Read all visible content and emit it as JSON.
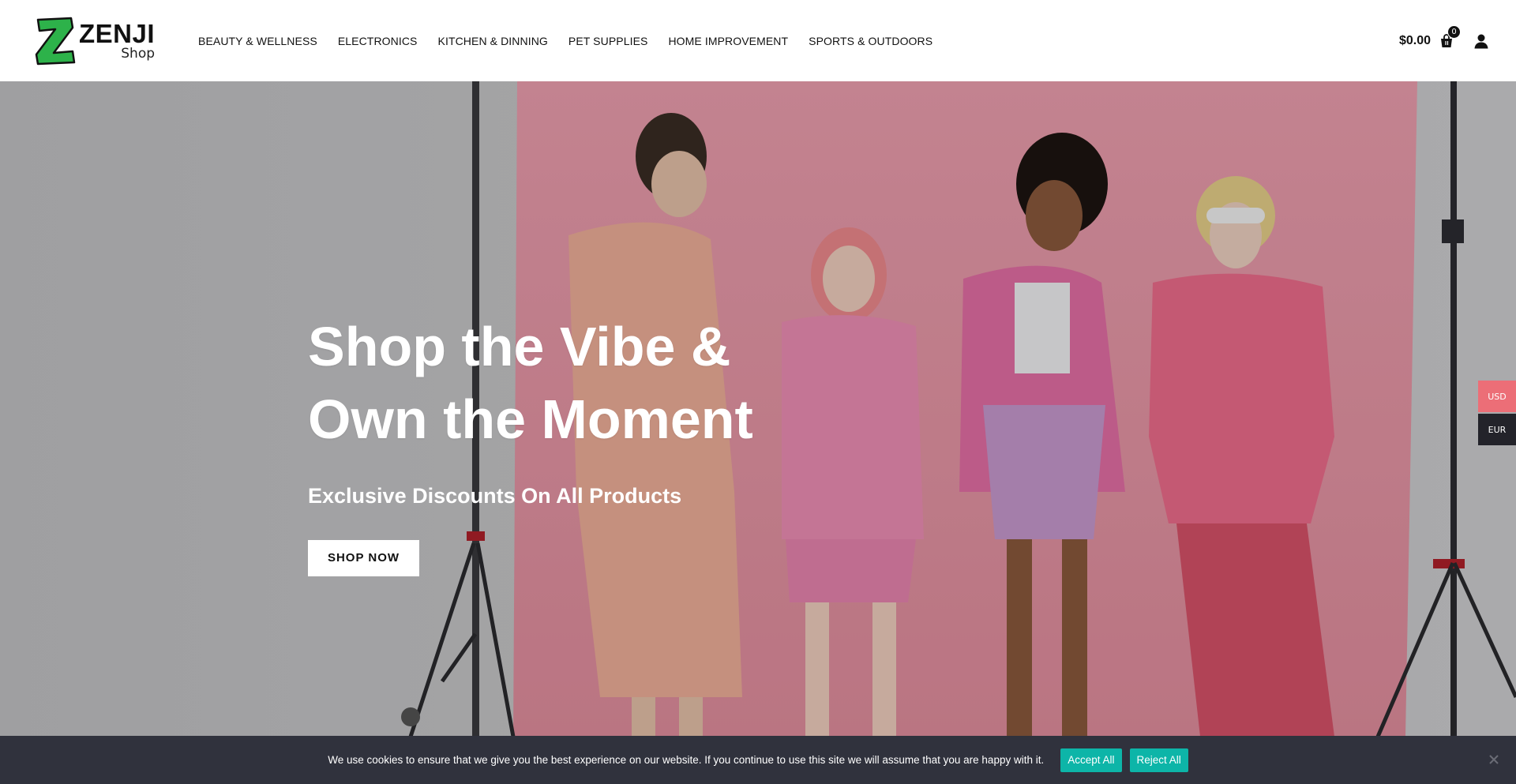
{
  "brand": {
    "name": "ZENJI",
    "sub": "Shop",
    "accent": "#2db24a"
  },
  "nav": {
    "items": [
      {
        "label": "BEAUTY & WELLNESS"
      },
      {
        "label": "ELECTRONICS"
      },
      {
        "label": "KITCHEN & DINNING"
      },
      {
        "label": "PET SUPPLIES"
      },
      {
        "label": "HOME IMPROVEMENT"
      },
      {
        "label": "SPORTS & OUTDOORS"
      }
    ]
  },
  "header": {
    "cart_total": "$0.00",
    "cart_count": "0",
    "cart_icon": "shopping-bag-icon",
    "user_icon": "user-icon"
  },
  "hero": {
    "title_line1": "Shop the Vibe &",
    "title_line2": "Own the Moment",
    "subtitle": "Exclusive Discounts On All Products",
    "cta": "SHOP NOW"
  },
  "currency": {
    "options": [
      "USD",
      "EUR"
    ],
    "selected": "USD",
    "usd_color": "#ec6e77",
    "eur_color": "#23232a"
  },
  "cookie": {
    "message": "We use cookies to ensure that we give you the best experience on our website. If you continue to use this site we will assume that you are happy with it.",
    "accept": "Accept All",
    "reject": "Reject All",
    "button_color": "#0db5a8",
    "bar_color": "#30323d"
  }
}
